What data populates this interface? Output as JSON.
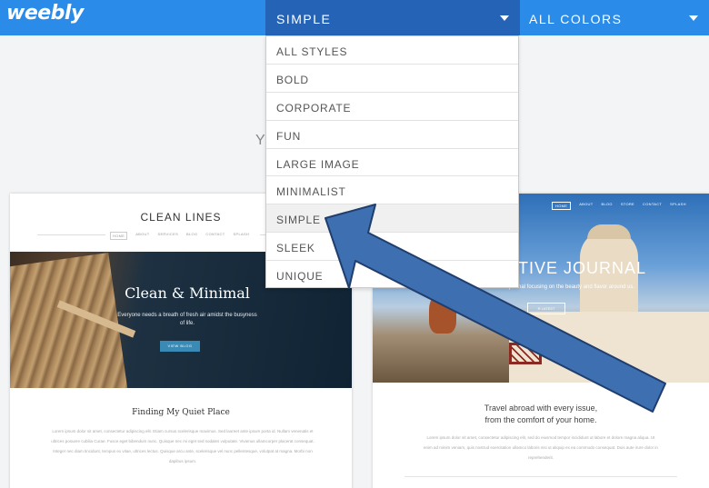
{
  "brand": {
    "logo_text": "weebly"
  },
  "header": {
    "style_filter": {
      "selected": "SIMPLE"
    },
    "color_filter": {
      "selected": "ALL COLORS"
    }
  },
  "page_heading_fragment": "Y",
  "dropdown": {
    "items": [
      {
        "label": "ALL STYLES"
      },
      {
        "label": "BOLD"
      },
      {
        "label": "CORPORATE"
      },
      {
        "label": "FUN"
      },
      {
        "label": "LARGE IMAGE"
      },
      {
        "label": "MINIMALIST"
      },
      {
        "label": "SIMPLE",
        "selected": true
      },
      {
        "label": "SLEEK"
      },
      {
        "label": "UNIQUE"
      }
    ]
  },
  "themes": {
    "left": {
      "site_title": "CLEAN LINES",
      "nav": [
        "HOME",
        "ABOUT",
        "SERVICES",
        "BLOG",
        "CONTACT",
        "SPLASH"
      ],
      "hero_title": "Clean & Minimal",
      "hero_subtitle": "Everyone needs a breath of fresh air amidst the busyness of life.",
      "hero_button": "VIEW BLOG",
      "section_title": "Finding My Quiet Place",
      "body_text": "Lorem ipsum dolor sit amet, consectetur adipiscing elit. Etiam cursus scelerisque maximus. Sed laoreet ante ipsum porta id. Nullam venenatis et ultrices posuere cubilia Curae. Fusce eget bibendum nunc. Quisque nec mi eget sed sodales vulputate. Vivamus ullamcorper placerat consequat. Integer nec diam tincidunt, tempus ex vitae, ultrices lectus. Quisque arcu ante, scelerisque vel nunc pellentesque, volutpat at magna. Morbi non dapibus ipsum."
    },
    "right": {
      "nav": [
        "HOME",
        "ABOUT",
        "BLOG",
        "STORE",
        "CONTACT",
        "SPLASH"
      ],
      "hero_title_fragment": "TIVE JOURNAL",
      "hero_subtitle_fragment": "journal focusing on the beauty and flavor around us.",
      "hero_button_fragment": "R LATEST",
      "tagline_line1": "Travel abroad with every issue,",
      "tagline_line2": "from the comfort of your home.",
      "body_text": "Lorem ipsum dolor sit amet, consectetur adipiscing elit, sed do eiusmod tempor incididunt ut labore et dolore magna aliqua. Ut enim ad minim veniam, quis nostrud exercitation ullamco laboris nisi ut aliquip ex ea commodo consequat. Duis aute irure dolor in reprehenderit."
    }
  },
  "annotation": {
    "arrow_color": "#3e6fb0",
    "arrow_outline": "#1f3e6e"
  },
  "colors": {
    "topbar": "#2b8be8",
    "topbar_active": "#2563b6"
  }
}
